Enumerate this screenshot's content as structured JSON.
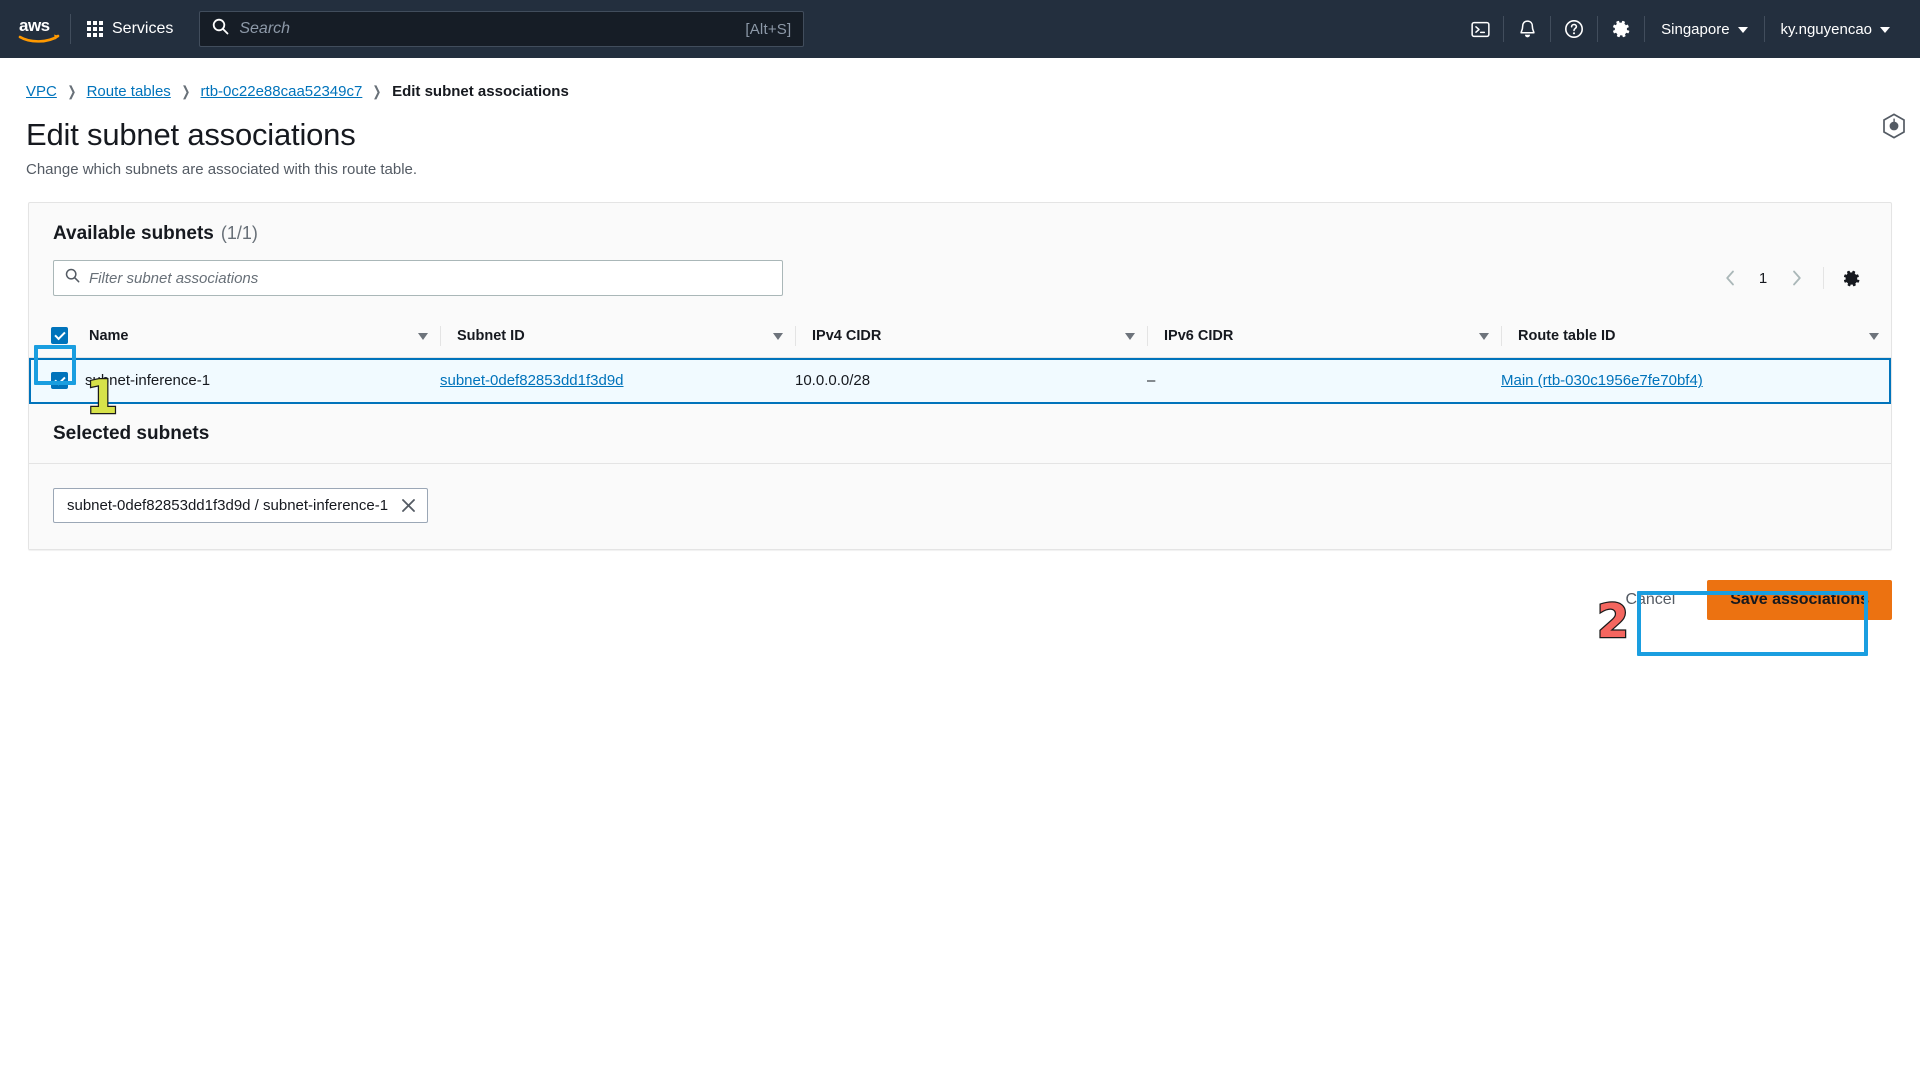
{
  "topnav": {
    "logo_alt": "aws",
    "services_label": "Services",
    "search": {
      "placeholder": "Search",
      "value": "",
      "shortcut": "[Alt+S]"
    },
    "cloudshell_icon": "cloudshell-icon",
    "notifications_icon": "bell-icon",
    "help_icon": "question-circle-icon",
    "settings_icon": "gear-icon",
    "region_label": "Singapore",
    "account_label": "ky.nguyencao"
  },
  "breadcrumb": [
    {
      "label": "VPC",
      "is_link": true
    },
    {
      "label": "Route tables",
      "is_link": true
    },
    {
      "label": "rtb-0c22e88caa52349c7",
      "is_link": true
    },
    {
      "label": "Edit subnet associations",
      "is_link": false
    }
  ],
  "page": {
    "title": "Edit subnet associations",
    "subtitle": "Change which subnets are associated with this route table."
  },
  "available_subnets": {
    "heading": "Available subnets",
    "counter": "(1/1)",
    "filter": {
      "placeholder": "Filter subnet associations",
      "value": ""
    },
    "pagination": {
      "prev_icon": "chevron-left-icon",
      "page": "1",
      "next_icon": "chevron-right-icon",
      "settings_icon": "gear-icon"
    },
    "columns": [
      "Name",
      "Subnet ID",
      "IPv4 CIDR",
      "IPv6 CIDR",
      "Route table ID"
    ],
    "rows": [
      {
        "selected": true,
        "name": "subnet-inference-1",
        "subnet_id": "subnet-0def82853dd1f3d9d",
        "ipv4_cidr": "10.0.0.0/28",
        "ipv6_cidr": "–",
        "route_table_id": "Main (rtb-030c1956e7fe70bf4)"
      }
    ]
  },
  "selected_subnets": {
    "heading": "Selected subnets",
    "tokens": [
      {
        "label": "subnet-0def82853dd1f3d9d / subnet-inference-1",
        "remove_icon": "close-icon"
      }
    ]
  },
  "actions": {
    "cancel_label": "Cancel",
    "save_label": "Save associations"
  },
  "annotations": [
    {
      "number": "1",
      "color": "#d7e24a"
    },
    {
      "number": "2",
      "color": "#f4665f"
    }
  ],
  "colors": {
    "nav_bg": "#232f3e",
    "link": "#0073bb",
    "primary_button": "#ec7211",
    "highlight": "#1a9ee0",
    "selected_row": "#f1faff"
  }
}
